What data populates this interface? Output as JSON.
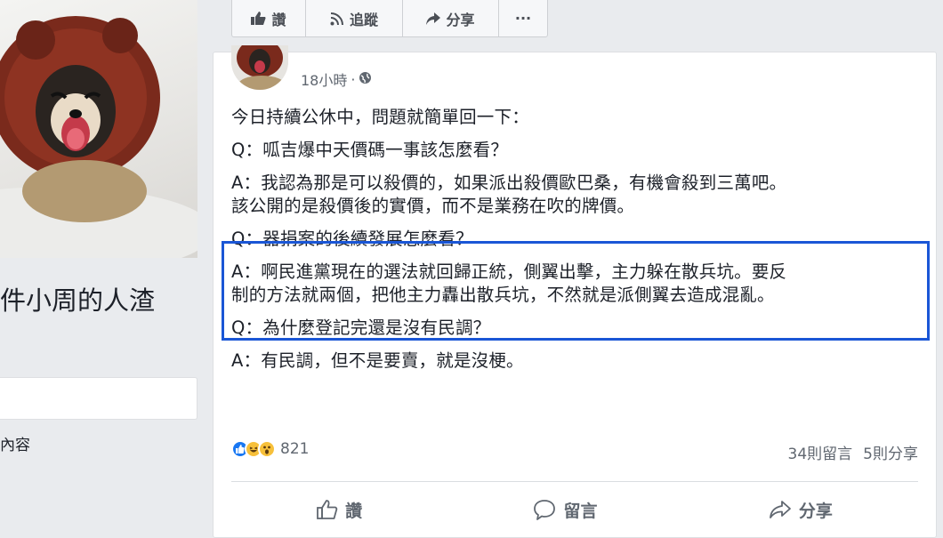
{
  "top_actions": [
    {
      "label": "讚",
      "icon": "thumbs-up-icon"
    },
    {
      "label": "追蹤",
      "icon": "rss-icon"
    },
    {
      "label": "分享",
      "icon": "share-arrow-icon"
    },
    {
      "label": "···",
      "icon": "more-icon"
    }
  ],
  "page": {
    "name_partial": "件小周的人渣",
    "sidebar_text": "內容"
  },
  "post": {
    "time": "18小時",
    "separator": "·",
    "privacy_icon": "globe-icon",
    "lines": [
      "今日持續公休中，問題就簡單回一下：",
      "Q：呱吉爆中天價碼一事該怎麼看？",
      "A：我認為那是可以殺價的，如果派出殺價歐巴桑，有機會殺到三萬吧。",
      "該公開的是殺價後的實價，而不是業務在吹的牌價。",
      "Q：器捐案的後續發展怎麼看？",
      "A：啊民進黨現在的選法就回歸正統，側翼出擊，主力躲在散兵坑。要反",
      "制的方法就兩個，把他主力轟出散兵坑，不然就是派側翼去造成混亂。",
      "Q：為什麼登記完還是沒有民調？",
      "A：有民調，但不是要賣，就是沒梗。"
    ],
    "reactions": {
      "icons": [
        "like-reaction-icon",
        "haha-reaction-icon",
        "wow-reaction-icon"
      ],
      "count": "821"
    },
    "comments": "34則留言",
    "shares": "5則分享"
  },
  "footer_actions": [
    {
      "label": "讚",
      "icon": "thumbs-up-outline-icon"
    },
    {
      "label": "留言",
      "icon": "comment-bubble-icon"
    },
    {
      "label": "分享",
      "icon": "share-outline-icon"
    }
  ],
  "colors": {
    "background": "#e9ebee",
    "highlight_border": "#1a56d6",
    "like_blue": "#1877f2",
    "emoji_yellow": "#f7c03a"
  }
}
